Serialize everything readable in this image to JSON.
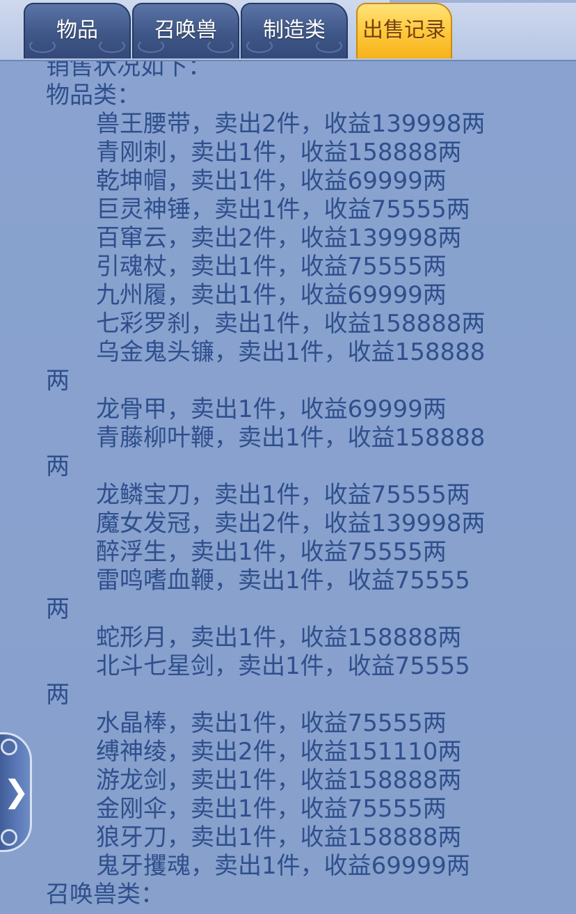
{
  "tabs": [
    {
      "label": "物品"
    },
    {
      "label": "召唤兽"
    },
    {
      "label": "制造类"
    },
    {
      "label": "出售记录"
    }
  ],
  "active_tab": "出售记录",
  "report": {
    "intro": "销售状况如下：",
    "category_items": "物品类：",
    "category_pets": "召唤兽类：",
    "lines": [
      "兽王腰带，卖出2件，收益139998两",
      "青刚刺，卖出1件，收益158888两",
      "乾坤帽，卖出1件，收益69999两",
      "巨灵神锤，卖出1件，收益75555两",
      "百窜云，卖出2件，收益139998两",
      "引魂杖，卖出1件，收益75555两",
      "九州履，卖出1件，收益69999两",
      "七彩罗刹，卖出1件，收益158888两",
      "乌金鬼头镰，卖出1件，收益158888",
      "两",
      "龙骨甲，卖出1件，收益69999两",
      "青藤柳叶鞭，卖出1件，收益158888",
      "两",
      "龙鳞宝刀，卖出1件，收益75555两",
      "魔女发冠，卖出2件，收益139998两",
      "醉浮生，卖出1件，收益75555两",
      "雷鸣嗜血鞭，卖出1件，收益75555",
      "两",
      "蛇形月，卖出1件，收益158888两",
      "北斗七星剑，卖出1件，收益75555",
      "两",
      "水晶棒，卖出1件，收益75555两",
      "缚神绫，卖出2件，收益151110两",
      "游龙剑，卖出1件，收益158888两",
      "金刚伞，卖出1件，收益75555两",
      "狼牙刀，卖出1件，收益158888两",
      "鬼牙攫魂，卖出1件，收益69999两"
    ]
  },
  "side_button": {
    "icon": "chevron-right-icon"
  }
}
